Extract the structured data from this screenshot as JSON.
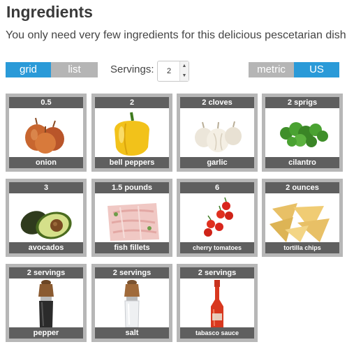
{
  "header": {
    "title": "Ingredients",
    "subtitle": "You only need very few ingredients for this delicious pescetarian dish."
  },
  "controls": {
    "view_toggle": {
      "options": [
        "grid",
        "list"
      ],
      "selected": "grid"
    },
    "servings": {
      "label": "Servings:",
      "value": "2"
    },
    "unit_toggle": {
      "options": [
        "metric",
        "US"
      ],
      "selected": "US"
    }
  },
  "colors": {
    "accent": "#2a9ad8",
    "inactive": "#b5b5b5",
    "card_border": "#b7b7b7"
  },
  "ingredients": [
    {
      "amount": "0.5",
      "name": "onion",
      "icon": "onion-image"
    },
    {
      "amount": "2",
      "name": "bell peppers",
      "icon": "bell-pepper-image"
    },
    {
      "amount": "2 cloves",
      "name": "garlic",
      "icon": "garlic-image"
    },
    {
      "amount": "2 sprigs",
      "name": "cilantro",
      "icon": "cilantro-image"
    },
    {
      "amount": "3",
      "name": "avocados",
      "icon": "avocado-image"
    },
    {
      "amount": "1.5 pounds",
      "name": "fish fillets",
      "icon": "fish-fillet-image"
    },
    {
      "amount": "6",
      "name": "cherry tomatoes",
      "icon": "cherry-tomato-image"
    },
    {
      "amount": "2 ounces",
      "name": "tortilla chips",
      "icon": "tortilla-chips-image"
    },
    {
      "amount": "2 servings",
      "name": "pepper",
      "icon": "pepper-mill-image"
    },
    {
      "amount": "2 servings",
      "name": "salt",
      "icon": "salt-mill-image"
    },
    {
      "amount": "2 servings",
      "name": "tabasco sauce",
      "icon": "tabasco-bottle-image"
    }
  ]
}
